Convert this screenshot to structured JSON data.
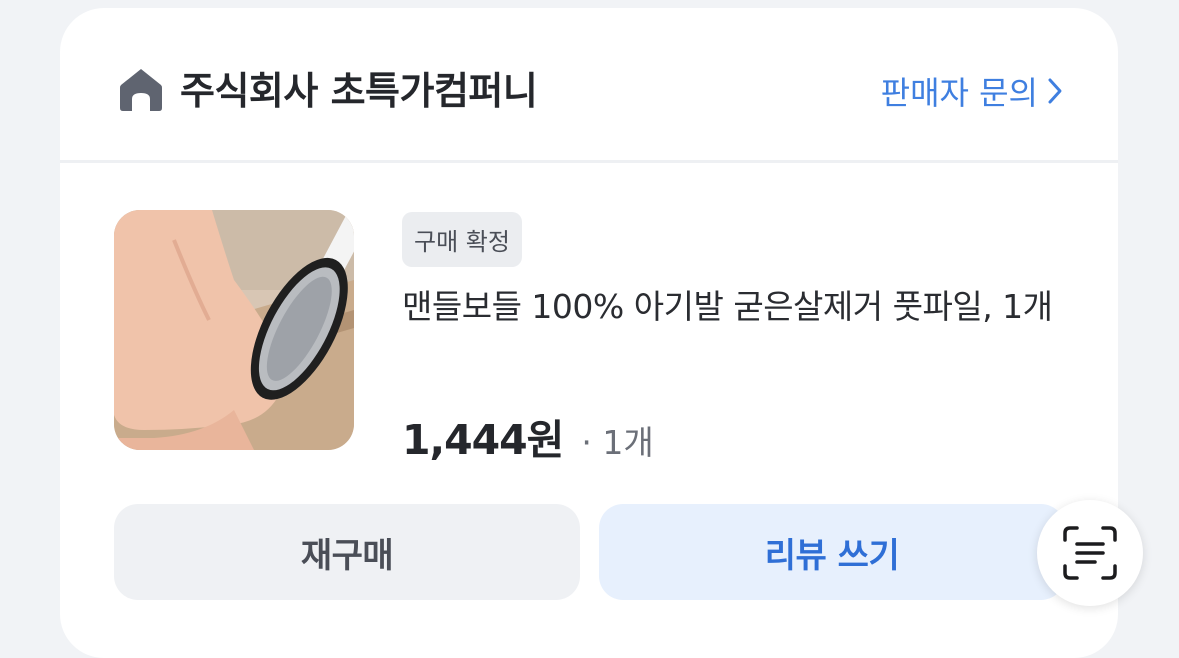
{
  "seller": {
    "icon": "home-icon",
    "name": "주식회사 초특가컴퍼니",
    "inquiry_label": "판매자 문의",
    "inquiry_icon": "chevron-right-icon"
  },
  "order_item": {
    "status_badge": "구매 확정",
    "product_name": "맨들보들 100% 아기발 굳은살제거 풋파일, 1개",
    "price": "1,444원",
    "quantity": "· 1개"
  },
  "actions": {
    "rebuy_label": "재구매",
    "review_label": "리뷰 쓰기"
  },
  "floating": {
    "icon": "text-scan-icon"
  },
  "colors": {
    "accent_blue": "#3f7fe0",
    "review_button_bg": "#e7f0fd",
    "page_bg": "#f1f3f6"
  }
}
